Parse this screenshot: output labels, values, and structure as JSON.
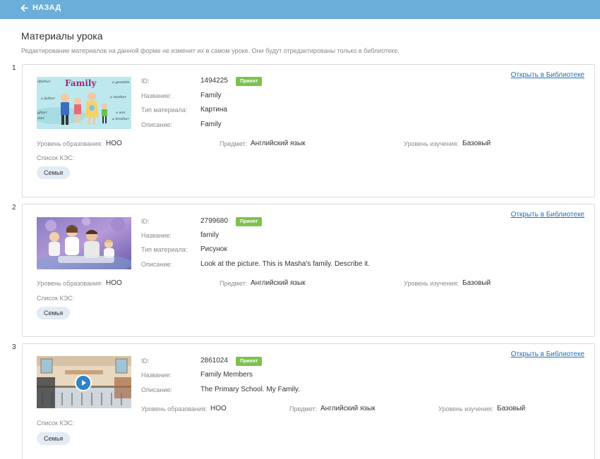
{
  "header": {
    "back_label": "НАЗАД",
    "back_icon": "arrow-left-icon",
    "bar_color": "#6aaed9"
  },
  "page": {
    "title": "Материалы урока",
    "subtitle": "Редактирование материалов на данной форме не изменит их в самом уроке. Они будут отредактированы только в библиотеке."
  },
  "labels": {
    "id": "ID:",
    "name": "Название:",
    "type": "Тип материала:",
    "description": "Описание:",
    "edu_level": "Уровень образования:",
    "subject": "Предмет:",
    "study_level": "Уровень изучения:",
    "kes": "Список КЭС:",
    "open_library": "Открыть в Библиотеке",
    "accepted": "Принят"
  },
  "colors": {
    "badge_accepted": "#7cc24b",
    "link": "#2a6fb0",
    "tag_bg": "#e3ebf4"
  },
  "materials": [
    {
      "number": "1",
      "id": "1494225",
      "name": "Family",
      "type": "Картина",
      "description": "Family",
      "edu_level": "НОО",
      "subject": "Английский язык",
      "study_level": "Базовый",
      "tag": "Семья",
      "thumb_text": {
        "title": "Family",
        "words": [
          "dfather",
          "a grandm",
          "a father",
          "a mother",
          "ghter",
          "ster",
          "a son",
          "a brother"
        ]
      }
    },
    {
      "number": "2",
      "id": "2799680",
      "name": "family",
      "type": "Рисунок",
      "description": "Look at the picture. This is Masha's family. Describe it.",
      "edu_level": "НОО",
      "subject": "Английский язык",
      "study_level": "Базовый",
      "tag": "Семья"
    },
    {
      "number": "3",
      "id": "2861024",
      "name": "Family Members",
      "description": "The Primary School. My Family.",
      "edu_level": "НОО",
      "subject": "Английский язык",
      "study_level": "Базовый",
      "tag": "Семья",
      "play_icon": "play-icon"
    }
  ]
}
